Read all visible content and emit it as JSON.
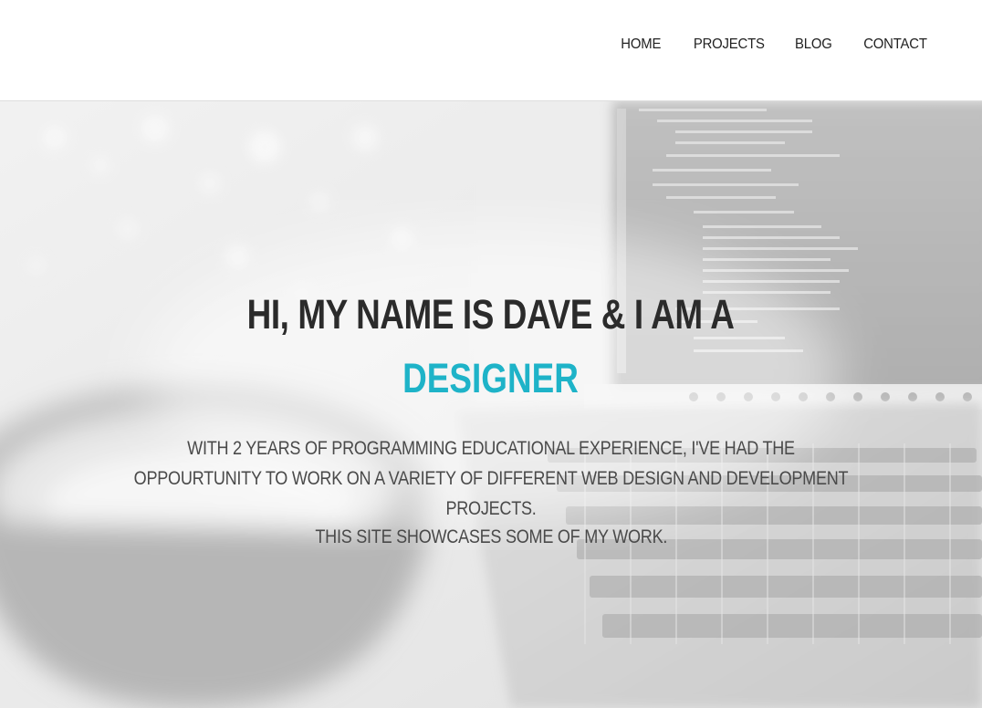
{
  "nav": {
    "items": [
      {
        "label": "HOME"
      },
      {
        "label": "PROJECTS"
      },
      {
        "label": "BLOG"
      },
      {
        "label": "CONTACT"
      }
    ]
  },
  "hero": {
    "headline": "HI, MY NAME IS DAVE & I AM A",
    "role": "DESIGNER",
    "intro": "WITH 2 YEARS OF PROGRAMMING EDUCATIONAL EXPERIENCE, I'VE HAD THE OPPOURTUNITY TO WORK ON A VARIETY OF DIFFERENT WEB DESIGN AND DEVELOPMENT PROJECTS.",
    "showcase": "THIS SITE SHOWCASES SOME OF MY WORK.",
    "background_image": "laptop-with-code-and-coffee-cup-photo"
  },
  "colors": {
    "accent": "#1eb3c8",
    "heading": "#2b2b2b",
    "body_text": "#4a4a4a",
    "nav_text": "#222222"
  }
}
